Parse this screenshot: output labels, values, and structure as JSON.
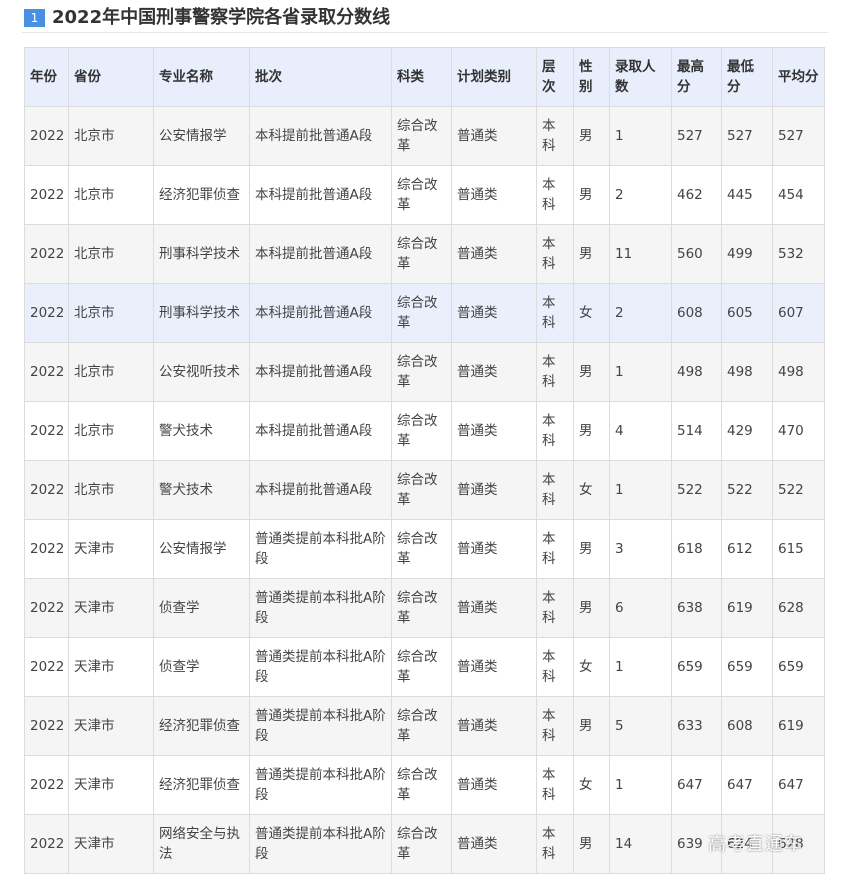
{
  "section": {
    "number": "1",
    "title": "2022年中国刑事警察学院各省录取分数线"
  },
  "table": {
    "headers": [
      "年份",
      "省份",
      "专业名称",
      "批次",
      "科类",
      "计划类别",
      "层次",
      "性别",
      "录取人数",
      "最高分",
      "最低分",
      "平均分"
    ],
    "rows": [
      [
        "2022",
        "北京市",
        "公安情报学",
        "本科提前批普通A段",
        "综合改革",
        "普通类",
        "本科",
        "男",
        "1",
        "527",
        "527",
        "527"
      ],
      [
        "2022",
        "北京市",
        "经济犯罪侦查",
        "本科提前批普通A段",
        "综合改革",
        "普通类",
        "本科",
        "男",
        "2",
        "462",
        "445",
        "454"
      ],
      [
        "2022",
        "北京市",
        "刑事科学技术",
        "本科提前批普通A段",
        "综合改革",
        "普通类",
        "本科",
        "男",
        "11",
        "560",
        "499",
        "532"
      ],
      [
        "2022",
        "北京市",
        "刑事科学技术",
        "本科提前批普通A段",
        "综合改革",
        "普通类",
        "本科",
        "女",
        "2",
        "608",
        "605",
        "607"
      ],
      [
        "2022",
        "北京市",
        "公安视听技术",
        "本科提前批普通A段",
        "综合改革",
        "普通类",
        "本科",
        "男",
        "1",
        "498",
        "498",
        "498"
      ],
      [
        "2022",
        "北京市",
        "警犬技术",
        "本科提前批普通A段",
        "综合改革",
        "普通类",
        "本科",
        "男",
        "4",
        "514",
        "429",
        "470"
      ],
      [
        "2022",
        "北京市",
        "警犬技术",
        "本科提前批普通A段",
        "综合改革",
        "普通类",
        "本科",
        "女",
        "1",
        "522",
        "522",
        "522"
      ],
      [
        "2022",
        "天津市",
        "公安情报学",
        "普通类提前本科批A阶段",
        "综合改革",
        "普通类",
        "本科",
        "男",
        "3",
        "618",
        "612",
        "615"
      ],
      [
        "2022",
        "天津市",
        "侦查学",
        "普通类提前本科批A阶段",
        "综合改革",
        "普通类",
        "本科",
        "男",
        "6",
        "638",
        "619",
        "628"
      ],
      [
        "2022",
        "天津市",
        "侦查学",
        "普通类提前本科批A阶段",
        "综合改革",
        "普通类",
        "本科",
        "女",
        "1",
        "659",
        "659",
        "659"
      ],
      [
        "2022",
        "天津市",
        "经济犯罪侦查",
        "普通类提前本科批A阶段",
        "综合改革",
        "普通类",
        "本科",
        "男",
        "5",
        "633",
        "608",
        "619"
      ],
      [
        "2022",
        "天津市",
        "经济犯罪侦查",
        "普通类提前本科批A阶段",
        "综合改革",
        "普通类",
        "本科",
        "女",
        "1",
        "647",
        "647",
        "647"
      ],
      [
        "2022",
        "天津市",
        "网络安全与执法",
        "普通类提前本科批A阶段",
        "综合改革",
        "普通类",
        "本科",
        "男",
        "14",
        "639",
        "624",
        "628"
      ]
    ],
    "highlight_row_index": 3
  },
  "watermark": "高考直通车",
  "colors": {
    "header_bg": "#e8eefc",
    "row_odd_bg": "#f5f5f5",
    "row_even_bg": "#ffffff",
    "highlight_bg": "#eaf0fb",
    "badge_bg": "#4a90e2"
  }
}
